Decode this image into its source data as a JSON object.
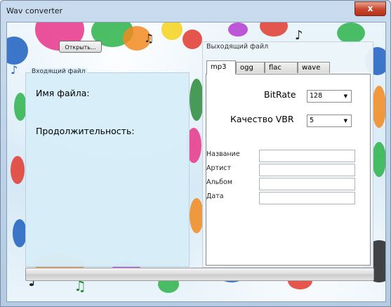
{
  "window": {
    "title": "Wav converter",
    "close_symbol": "x"
  },
  "toolbar": {
    "open_label": "Открыть..."
  },
  "input_group": {
    "legend": "Входящий файл",
    "filename_label": "Имя файла:",
    "duration_label": "Продолжительность:"
  },
  "output_group": {
    "legend": "Выходящий файл",
    "tabs": [
      {
        "label": "mp3",
        "active": true
      },
      {
        "label": "ogg",
        "active": false
      },
      {
        "label": "flac",
        "active": false
      },
      {
        "label": "wave",
        "active": false
      }
    ],
    "mp3": {
      "bitrate_label": "BitRate",
      "bitrate_value": "128",
      "vbr_label": "Качество VBR",
      "vbr_value": "5",
      "fields": [
        {
          "label": "Название",
          "value": ""
        },
        {
          "label": "Артист",
          "value": ""
        },
        {
          "label": "Альбом",
          "value": ""
        },
        {
          "label": "Дата",
          "value": ""
        }
      ]
    }
  },
  "progress": {
    "value": 0
  },
  "colors": {
    "title_close": "#c8452c",
    "tab_border": "#8c8c8c",
    "input_group_bg": "#d7edf8"
  }
}
